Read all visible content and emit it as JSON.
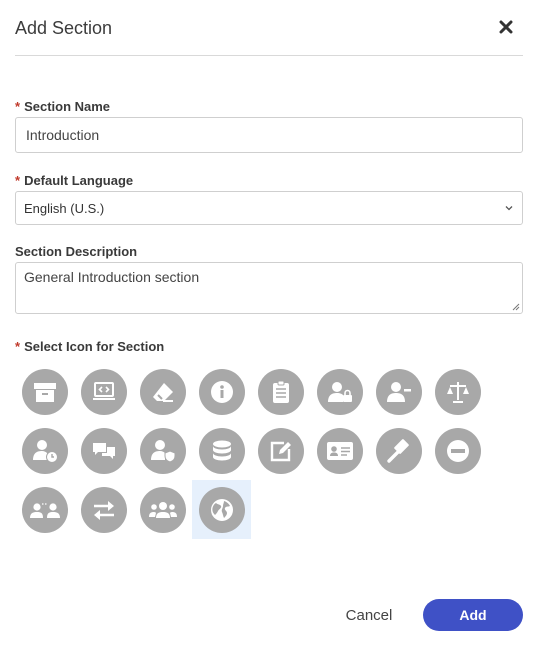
{
  "dialog": {
    "title": "Add Section",
    "close_icon": "close-icon"
  },
  "fields": {
    "section_name": {
      "required_mark": "*",
      "label": "Section Name",
      "value": "Introduction"
    },
    "default_language": {
      "required_mark": "*",
      "label": "Default Language",
      "value": "English (U.S.)"
    },
    "section_description": {
      "label": "Section Description",
      "value": "General Introduction section"
    },
    "icon": {
      "required_mark": "*",
      "label": "Select Icon for Section"
    }
  },
  "icons": [
    "archive-box-icon",
    "code-laptop-icon",
    "eraser-icon",
    "info-icon",
    "clipboard-list-icon",
    "user-lock-icon",
    "user-minus-icon",
    "balance-scale-icon",
    "user-clock-icon",
    "chat-bubbles-icon",
    "user-shield-icon",
    "database-icon",
    "edit-icon",
    "id-card-icon",
    "gavel-icon",
    "minus-circle-icon",
    "user-transfer-icon",
    "exchange-arrows-icon",
    "users-group-icon",
    "globe-icon"
  ],
  "selected_icon": "globe-icon",
  "colors": {
    "icon_circle": "#a8a8a8",
    "selected_bg": "#e6f0fc",
    "primary": "#3f51c6",
    "required": "#c0392b"
  },
  "buttons": {
    "cancel": "Cancel",
    "add": "Add"
  }
}
